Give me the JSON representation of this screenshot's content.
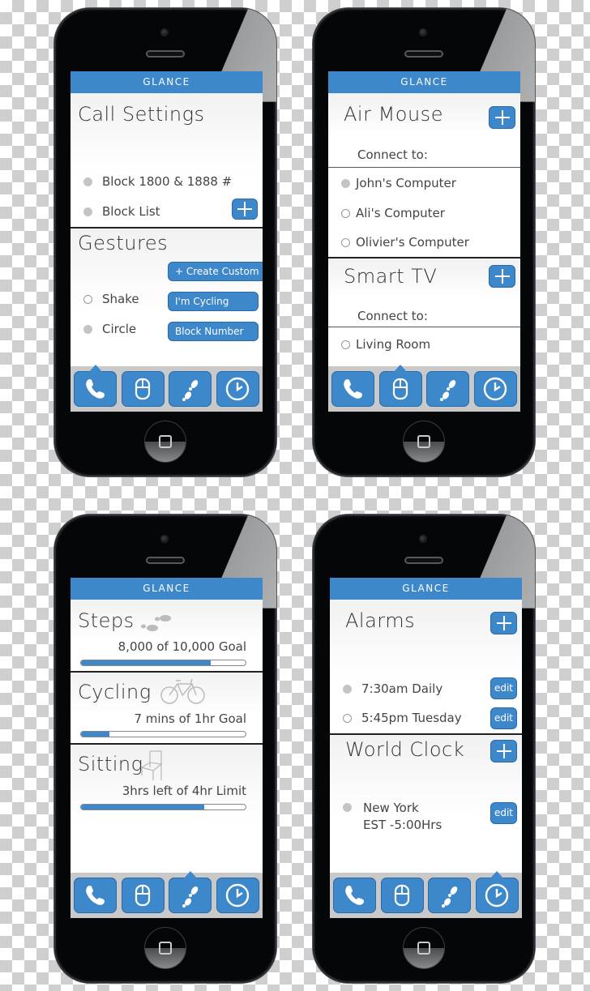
{
  "app_name": "GLANCE",
  "colors": {
    "accent": "#3d87cb",
    "tabbar_bg": "#c9c9c9",
    "text": "#333333"
  },
  "tabs": [
    {
      "name": "calls",
      "icon": "phone-icon"
    },
    {
      "name": "mouse",
      "icon": "mouse-icon"
    },
    {
      "name": "activity",
      "icon": "footsteps-icon"
    },
    {
      "name": "clock",
      "icon": "clock-icon"
    }
  ],
  "screens": {
    "call_settings": {
      "active_tab": "calls",
      "title": "Call Settings",
      "items": [
        {
          "label": "Block 1800 & 1888 #",
          "selected": true
        },
        {
          "label": "Block List",
          "selected": true
        }
      ],
      "gestures": {
        "title": "Gestures",
        "create_button": "+ Create Custom",
        "items": [
          {
            "label": "Shake",
            "selected": false,
            "action": "I'm Cycling"
          },
          {
            "label": "Circle",
            "selected": true,
            "action": "Block Number"
          }
        ]
      }
    },
    "air_mouse": {
      "active_tab": "mouse",
      "title": "Air Mouse",
      "connect_label": "Connect to:",
      "items": [
        {
          "label": "John's Computer",
          "selected": true
        },
        {
          "label": "Ali's Computer",
          "selected": false
        },
        {
          "label": "Olivier's Computer",
          "selected": false
        }
      ],
      "smart_tv": {
        "title": "Smart TV",
        "connect_label": "Connect to:",
        "items": [
          {
            "label": "Living Room",
            "selected": false
          }
        ]
      }
    },
    "activity": {
      "active_tab": "activity",
      "metrics": [
        {
          "title": "Steps",
          "icon": "footsteps-icon",
          "label": "8,000 of 10,000 Goal",
          "progress": 0.79
        },
        {
          "title": "Cycling",
          "icon": "bicycle-icon",
          "label": "7 mins of 1hr Goal",
          "progress": 0.17
        },
        {
          "title": "Sitting",
          "icon": "chair-icon",
          "label": "3hrs left of 4hr Limit",
          "progress": 0.75
        }
      ]
    },
    "alarms": {
      "active_tab": "clock",
      "title": "Alarms",
      "items": [
        {
          "label": "7:30am Daily",
          "selected": true,
          "edit": "edit"
        },
        {
          "label": "5:45pm Tuesday",
          "selected": false,
          "edit": "edit"
        }
      ],
      "world_clock": {
        "title": "World Clock",
        "items": [
          {
            "city": "New York",
            "offset": "EST -5:00Hrs",
            "selected": true,
            "edit": "edit"
          }
        ]
      }
    }
  }
}
